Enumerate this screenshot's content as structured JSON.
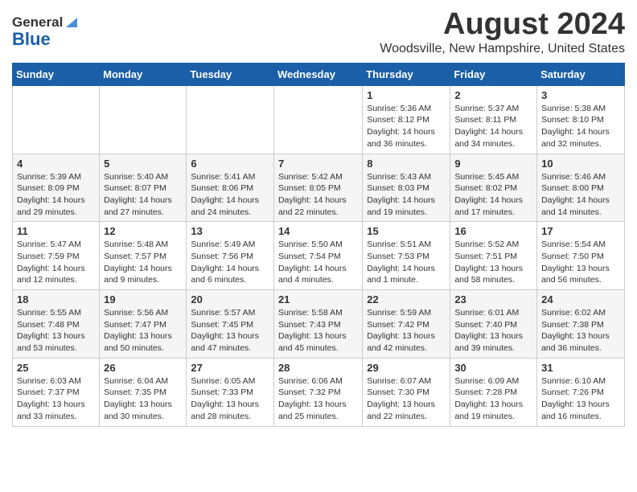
{
  "header": {
    "logo_general": "General",
    "logo_blue": "Blue",
    "month_title": "August 2024",
    "location": "Woodsville, New Hampshire, United States"
  },
  "weekdays": [
    "Sunday",
    "Monday",
    "Tuesday",
    "Wednesday",
    "Thursday",
    "Friday",
    "Saturday"
  ],
  "weeks": [
    [
      {
        "day": "",
        "info": ""
      },
      {
        "day": "",
        "info": ""
      },
      {
        "day": "",
        "info": ""
      },
      {
        "day": "",
        "info": ""
      },
      {
        "day": "1",
        "info": "Sunrise: 5:36 AM\nSunset: 8:12 PM\nDaylight: 14 hours and 36 minutes."
      },
      {
        "day": "2",
        "info": "Sunrise: 5:37 AM\nSunset: 8:11 PM\nDaylight: 14 hours and 34 minutes."
      },
      {
        "day": "3",
        "info": "Sunrise: 5:38 AM\nSunset: 8:10 PM\nDaylight: 14 hours and 32 minutes."
      }
    ],
    [
      {
        "day": "4",
        "info": "Sunrise: 5:39 AM\nSunset: 8:09 PM\nDaylight: 14 hours and 29 minutes."
      },
      {
        "day": "5",
        "info": "Sunrise: 5:40 AM\nSunset: 8:07 PM\nDaylight: 14 hours and 27 minutes."
      },
      {
        "day": "6",
        "info": "Sunrise: 5:41 AM\nSunset: 8:06 PM\nDaylight: 14 hours and 24 minutes."
      },
      {
        "day": "7",
        "info": "Sunrise: 5:42 AM\nSunset: 8:05 PM\nDaylight: 14 hours and 22 minutes."
      },
      {
        "day": "8",
        "info": "Sunrise: 5:43 AM\nSunset: 8:03 PM\nDaylight: 14 hours and 19 minutes."
      },
      {
        "day": "9",
        "info": "Sunrise: 5:45 AM\nSunset: 8:02 PM\nDaylight: 14 hours and 17 minutes."
      },
      {
        "day": "10",
        "info": "Sunrise: 5:46 AM\nSunset: 8:00 PM\nDaylight: 14 hours and 14 minutes."
      }
    ],
    [
      {
        "day": "11",
        "info": "Sunrise: 5:47 AM\nSunset: 7:59 PM\nDaylight: 14 hours and 12 minutes."
      },
      {
        "day": "12",
        "info": "Sunrise: 5:48 AM\nSunset: 7:57 PM\nDaylight: 14 hours and 9 minutes."
      },
      {
        "day": "13",
        "info": "Sunrise: 5:49 AM\nSunset: 7:56 PM\nDaylight: 14 hours and 6 minutes."
      },
      {
        "day": "14",
        "info": "Sunrise: 5:50 AM\nSunset: 7:54 PM\nDaylight: 14 hours and 4 minutes."
      },
      {
        "day": "15",
        "info": "Sunrise: 5:51 AM\nSunset: 7:53 PM\nDaylight: 14 hours and 1 minute."
      },
      {
        "day": "16",
        "info": "Sunrise: 5:52 AM\nSunset: 7:51 PM\nDaylight: 13 hours and 58 minutes."
      },
      {
        "day": "17",
        "info": "Sunrise: 5:54 AM\nSunset: 7:50 PM\nDaylight: 13 hours and 56 minutes."
      }
    ],
    [
      {
        "day": "18",
        "info": "Sunrise: 5:55 AM\nSunset: 7:48 PM\nDaylight: 13 hours and 53 minutes."
      },
      {
        "day": "19",
        "info": "Sunrise: 5:56 AM\nSunset: 7:47 PM\nDaylight: 13 hours and 50 minutes."
      },
      {
        "day": "20",
        "info": "Sunrise: 5:57 AM\nSunset: 7:45 PM\nDaylight: 13 hours and 47 minutes."
      },
      {
        "day": "21",
        "info": "Sunrise: 5:58 AM\nSunset: 7:43 PM\nDaylight: 13 hours and 45 minutes."
      },
      {
        "day": "22",
        "info": "Sunrise: 5:59 AM\nSunset: 7:42 PM\nDaylight: 13 hours and 42 minutes."
      },
      {
        "day": "23",
        "info": "Sunrise: 6:01 AM\nSunset: 7:40 PM\nDaylight: 13 hours and 39 minutes."
      },
      {
        "day": "24",
        "info": "Sunrise: 6:02 AM\nSunset: 7:38 PM\nDaylight: 13 hours and 36 minutes."
      }
    ],
    [
      {
        "day": "25",
        "info": "Sunrise: 6:03 AM\nSunset: 7:37 PM\nDaylight: 13 hours and 33 minutes."
      },
      {
        "day": "26",
        "info": "Sunrise: 6:04 AM\nSunset: 7:35 PM\nDaylight: 13 hours and 30 minutes."
      },
      {
        "day": "27",
        "info": "Sunrise: 6:05 AM\nSunset: 7:33 PM\nDaylight: 13 hours and 28 minutes."
      },
      {
        "day": "28",
        "info": "Sunrise: 6:06 AM\nSunset: 7:32 PM\nDaylight: 13 hours and 25 minutes."
      },
      {
        "day": "29",
        "info": "Sunrise: 6:07 AM\nSunset: 7:30 PM\nDaylight: 13 hours and 22 minutes."
      },
      {
        "day": "30",
        "info": "Sunrise: 6:09 AM\nSunset: 7:28 PM\nDaylight: 13 hours and 19 minutes."
      },
      {
        "day": "31",
        "info": "Sunrise: 6:10 AM\nSunset: 7:26 PM\nDaylight: 13 hours and 16 minutes."
      }
    ]
  ]
}
